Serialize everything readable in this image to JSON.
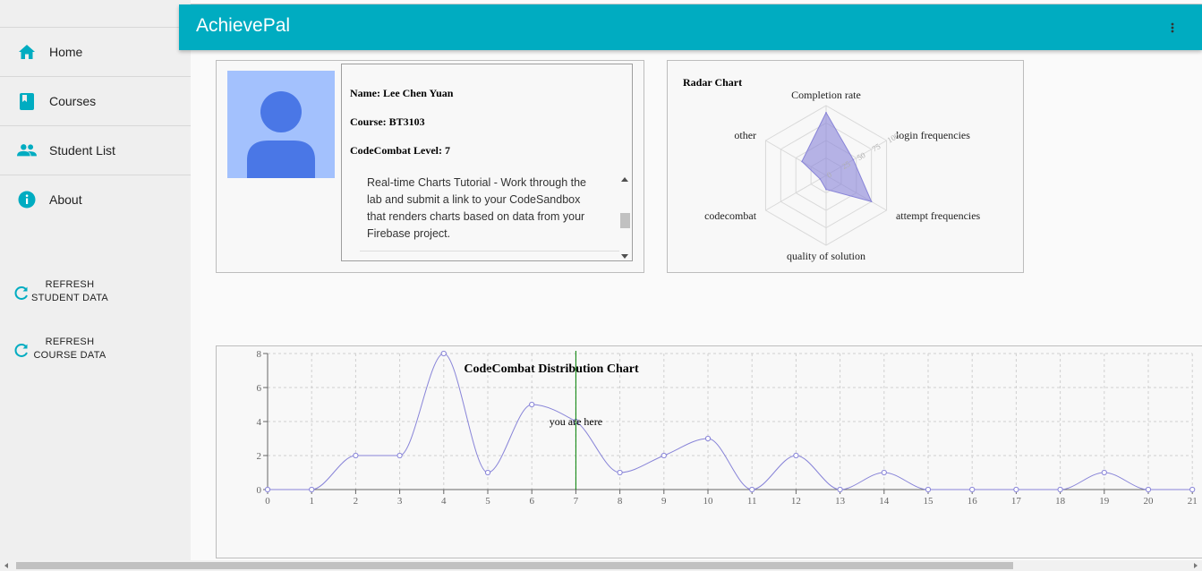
{
  "app": {
    "title": "AchievePal"
  },
  "sidebar": {
    "items": [
      {
        "label": "Home",
        "icon": "home-icon"
      },
      {
        "label": "Courses",
        "icon": "book-icon"
      },
      {
        "label": "Student List",
        "icon": "people-icon"
      },
      {
        "label": "About",
        "icon": "info-icon"
      }
    ],
    "refresh_student": {
      "line1": "REFRESH",
      "line2": "STUDENT DATA",
      "icon": "refresh-icon"
    },
    "refresh_course": {
      "line1": "REFRESH",
      "line2": "COURSE DATA",
      "icon": "refresh-icon"
    }
  },
  "profile": {
    "name": "Name: Lee Chen Yuan",
    "course": "Course: BT3103",
    "level": "CodeCombat Level: 7",
    "description": "Real-time Charts Tutorial - Work through the lab and submit a link to your CodeSandbox that renders charts based on data from your Firebase project."
  },
  "colors": {
    "accent": "#00acc1",
    "chart": "#8884d8",
    "marker": "#008000",
    "avatar_bg": "#a3c1fd",
    "avatar_fg": "#4a77e6"
  },
  "chart_data": [
    {
      "type": "radar",
      "title": "Radar Chart",
      "axes": [
        "Completion rate",
        "login frequencies",
        "attempt frequencies",
        "quality of solution",
        "codecombat",
        "other"
      ],
      "values": [
        90,
        45,
        75,
        20,
        10,
        40
      ],
      "radial_ticks": [
        "0",
        "25",
        "50",
        "75",
        "100"
      ],
      "rmax": 100
    },
    {
      "type": "line",
      "title": "CodeCombat Distribution Chart",
      "x": [
        0,
        1,
        2,
        3,
        4,
        5,
        6,
        7,
        8,
        9,
        10,
        11,
        12,
        13,
        14,
        15,
        16,
        17,
        18,
        19,
        20,
        21
      ],
      "y": [
        0,
        0,
        2,
        2,
        8,
        1,
        5,
        4,
        1,
        2,
        3,
        0,
        2,
        0,
        1,
        0,
        0,
        0,
        0,
        1,
        0,
        0
      ],
      "yticks": [
        0,
        2,
        4,
        6,
        8
      ],
      "ylim": [
        0,
        8
      ],
      "marker_x": 7,
      "marker_label": "you are here",
      "grid": true
    }
  ]
}
